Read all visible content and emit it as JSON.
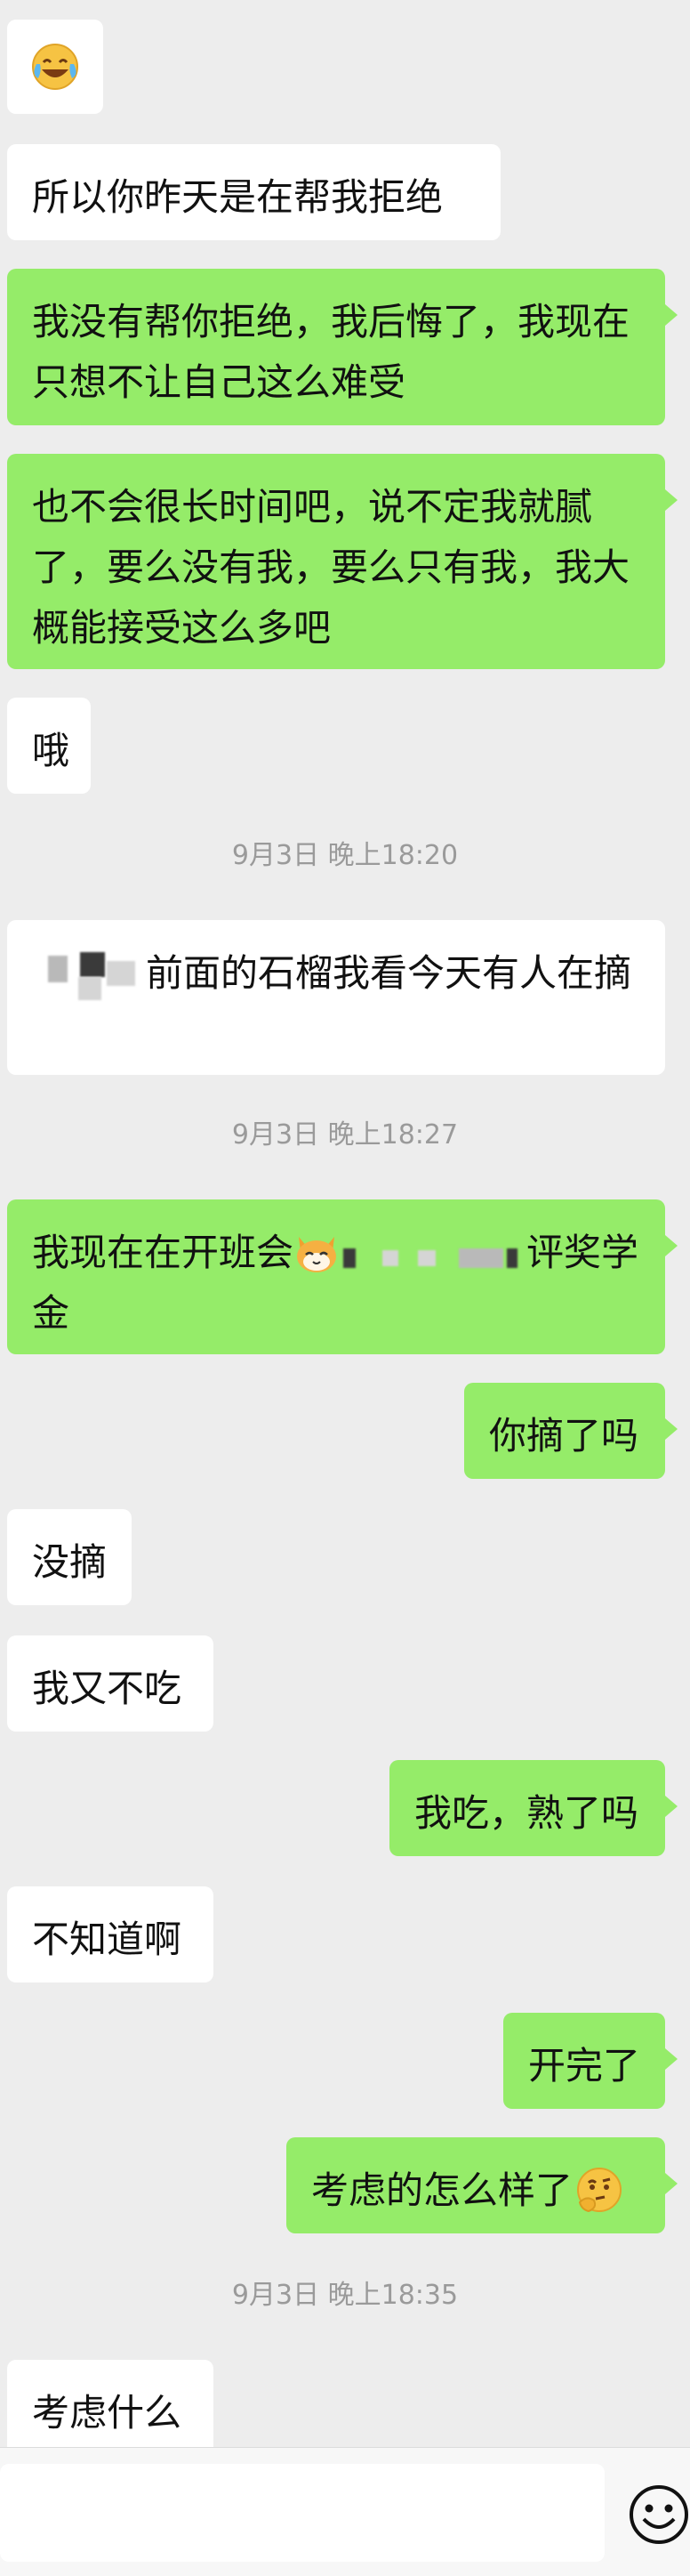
{
  "messages": {
    "m1_emoji": "laughing-crying-emoji",
    "m2": "所以你昨天是在帮我拒绝",
    "m3": "我没有帮你拒绝，我后悔了，我现在只想不让自己这么难受",
    "m4": "也不会很长时间吧，说不定我就腻了，要么没有我，要么只有我，我大概能接受这么多吧",
    "m5": "哦",
    "m6": "前面的石榴我看今天有人在摘",
    "m7_a": "我现在在开班会",
    "m7_b": "评奖学金",
    "m8": "你摘了吗",
    "m9": "没摘",
    "m10": "我又不吃",
    "m11": "我吃，熟了吗",
    "m12": "不知道啊",
    "m13": "开完了",
    "m14": "考虑的怎么样了",
    "m15": "考虑什么"
  },
  "timestamps": {
    "t1": "9月3日 晚上18:20",
    "t2": "9月3日 晚上18:27",
    "t3": "9月3日 晚上18:35"
  },
  "colors": {
    "background": "#ededed",
    "outgoing": "#95ec69",
    "incoming": "#ffffff",
    "timestamp": "#9a9a9a"
  },
  "input": {
    "value": "",
    "emoji_button": "smiley-icon"
  }
}
